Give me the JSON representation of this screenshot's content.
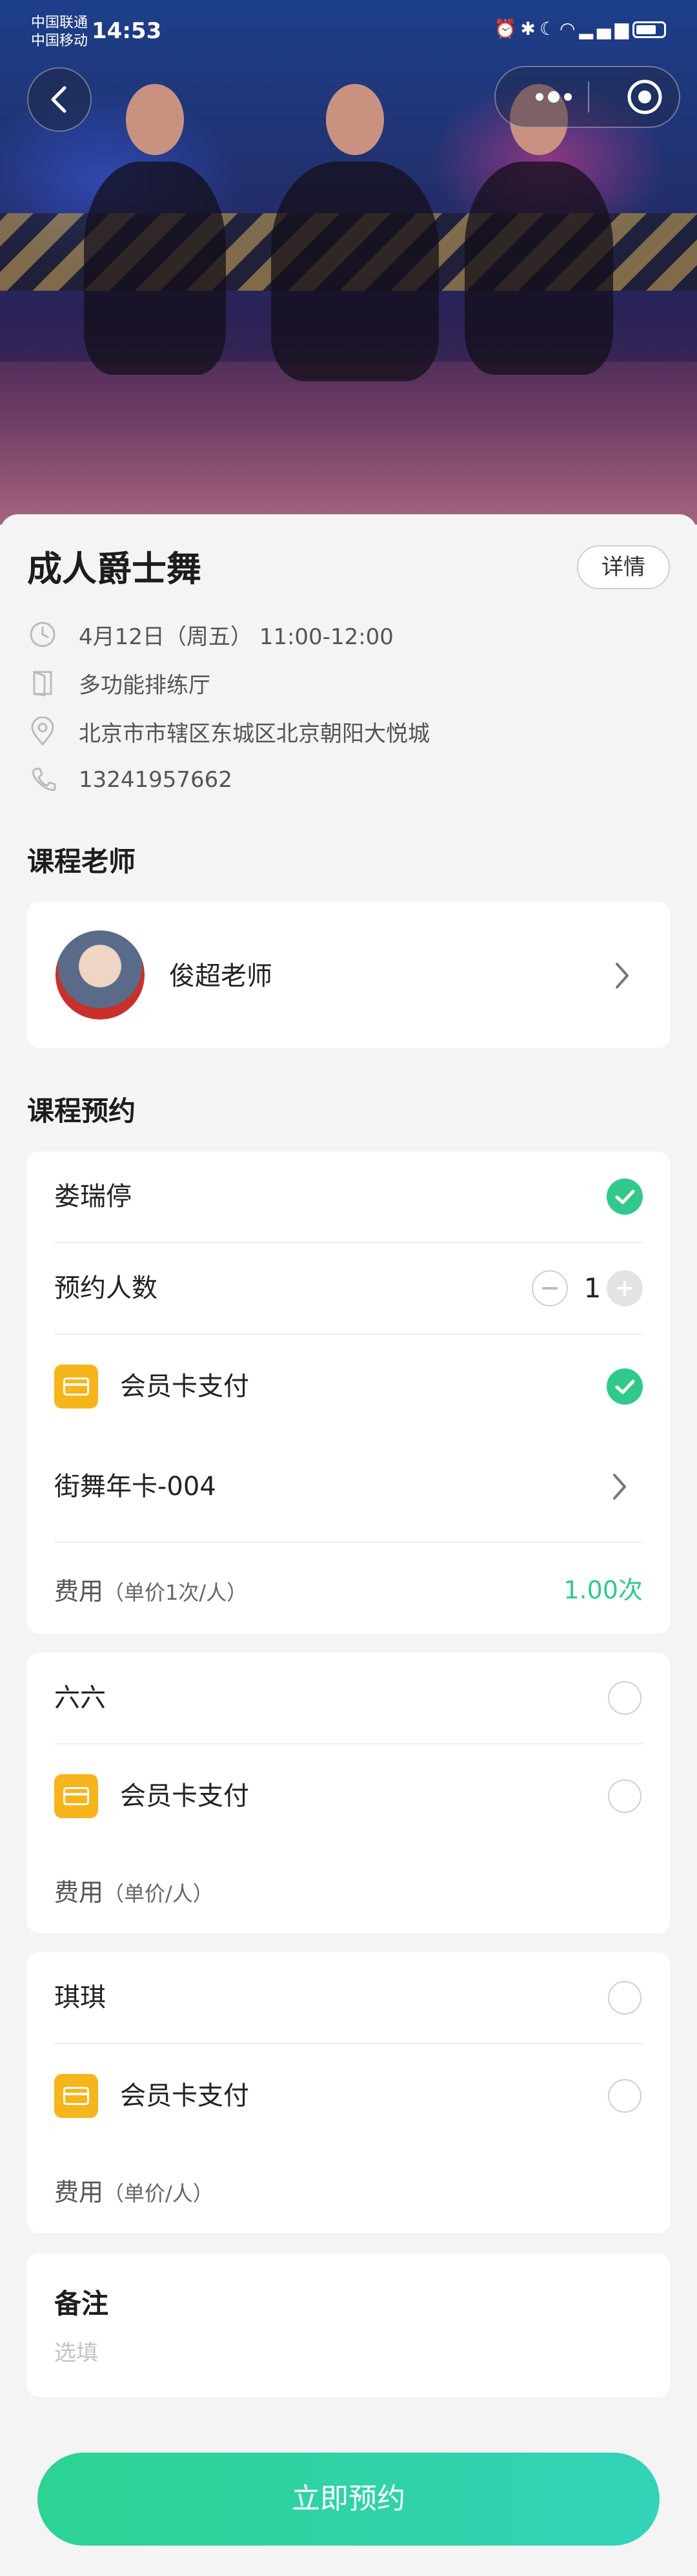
{
  "status_bar": {
    "carrier1": "中国联通",
    "carrier2": "中国移动",
    "time": "14:53"
  },
  "course": {
    "title": "成人爵士舞",
    "detail_button": "详情",
    "datetime": "4月12日（周五） 11:00-12:00",
    "room": "多功能排练厅",
    "address": "北京市市辖区东城区北京朝阳大悦城",
    "phone": "13241957662"
  },
  "teacher_section": {
    "heading": "课程老师",
    "teacher_name": "俊超老师"
  },
  "booking_section": {
    "heading": "课程预约",
    "members": [
      {
        "name": "娄瑞停",
        "selected": true,
        "count_label": "预约人数",
        "count": "1",
        "pay_method": "会员卡支付",
        "pay_selected": true,
        "card_name": "街舞年卡-004",
        "fee_label": "费用",
        "fee_note": "（单价1次/人）",
        "fee_value": "1.00次"
      },
      {
        "name": "六六",
        "selected": false,
        "pay_method": "会员卡支付",
        "pay_selected": false,
        "fee_label": "费用",
        "fee_note": "（单价/人）"
      },
      {
        "name": "琪琪",
        "selected": false,
        "pay_method": "会员卡支付",
        "pay_selected": false,
        "fee_label": "费用",
        "fee_note": "（单价/人）"
      }
    ]
  },
  "remark": {
    "heading": "备注",
    "placeholder": "选填"
  },
  "submit_button": "立即预约",
  "colors": {
    "accent": "#30c98b",
    "pay_icon": "#f7b51c"
  }
}
